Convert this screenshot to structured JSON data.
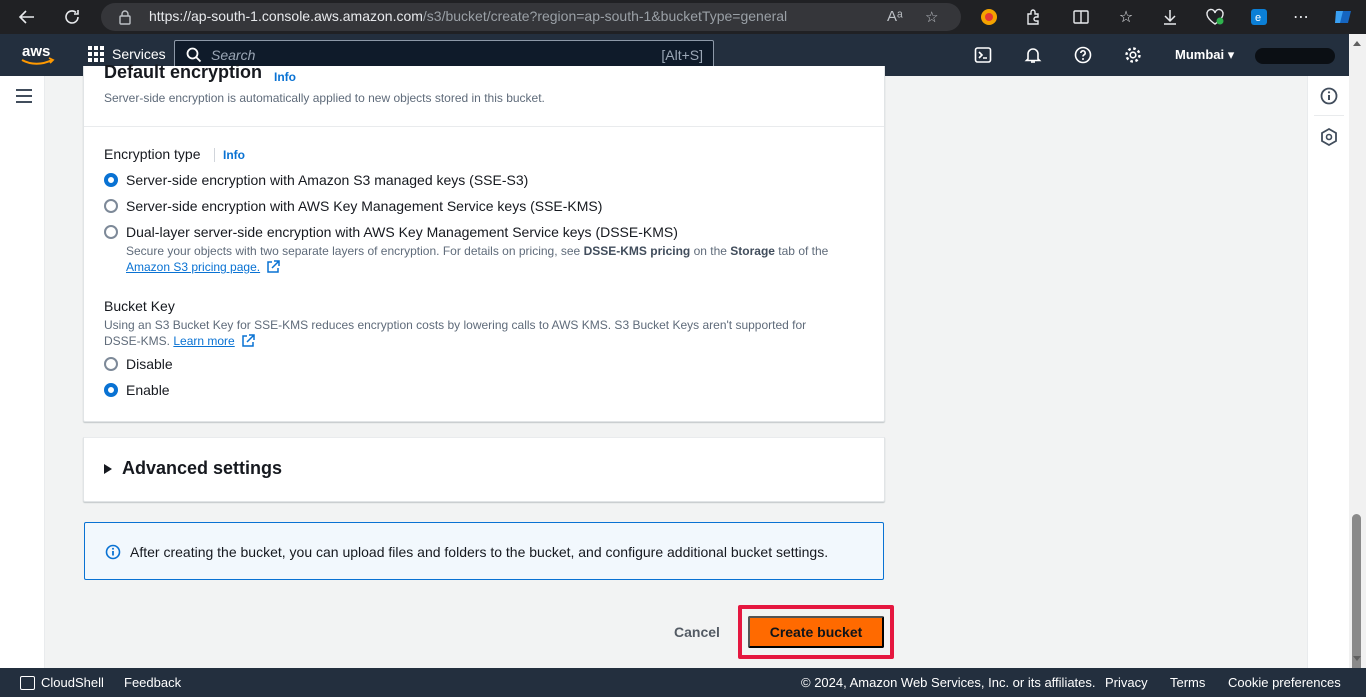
{
  "browser": {
    "url_host": "https://ap-south-1.console.aws.amazon.com",
    "url_path": "/s3/bucket/create?region=ap-south-1&bucketType=general",
    "read_aloud": "Aᵃ"
  },
  "aws_nav": {
    "logo": "aws",
    "services_label": "Services",
    "search_placeholder": "Search",
    "search_shortcut": "[Alt+S]",
    "region": "Mumbai ▾"
  },
  "encryption": {
    "heading": "Default encryption",
    "heading_info": "Info",
    "description": "Server-side encryption is automatically applied to new objects stored in this bucket.",
    "type_label": "Encryption type",
    "type_info": "Info",
    "options": [
      {
        "label": "Server-side encryption with Amazon S3 managed keys (SSE-S3)",
        "checked": true
      },
      {
        "label": "Server-side encryption with AWS Key Management Service keys (SSE-KMS)",
        "checked": false
      },
      {
        "label": "Dual-layer server-side encryption with AWS Key Management Service keys (DSSE-KMS)",
        "checked": false
      }
    ],
    "dsse_help_1": "Secure your objects with two separate layers of encryption. For details on pricing, see ",
    "dsse_help_bold1": "DSSE-KMS pricing",
    "dsse_help_2": " on the ",
    "dsse_help_bold2": "Storage",
    "dsse_help_3": " tab of the",
    "dsse_help_link": "Amazon S3 pricing page.",
    "bucket_key_label": "Bucket Key",
    "bucket_key_help": "Using an S3 Bucket Key for SSE-KMS reduces encryption costs by lowering calls to AWS KMS. S3 Bucket Keys aren't supported for DSSE-KMS.",
    "learn_more": "Learn more",
    "bucket_key_options": [
      {
        "label": "Disable",
        "checked": false
      },
      {
        "label": "Enable",
        "checked": true
      }
    ]
  },
  "advanced": {
    "label": "Advanced settings"
  },
  "alert": {
    "text": "After creating the bucket, you can upload files and folders to the bucket, and configure additional bucket settings."
  },
  "actions": {
    "cancel": "Cancel",
    "create": "Create bucket"
  },
  "footer": {
    "cloudshell": "CloudShell",
    "feedback": "Feedback",
    "copyright": "© 2024, Amazon Web Services, Inc. or its affiliates.",
    "privacy": "Privacy",
    "terms": "Terms",
    "cookies": "Cookie preferences"
  },
  "colors": {
    "accent": "#0972d3",
    "primary_button": "#ff6a00",
    "highlight": "#e5173f",
    "nav_bg": "#232f3e"
  }
}
